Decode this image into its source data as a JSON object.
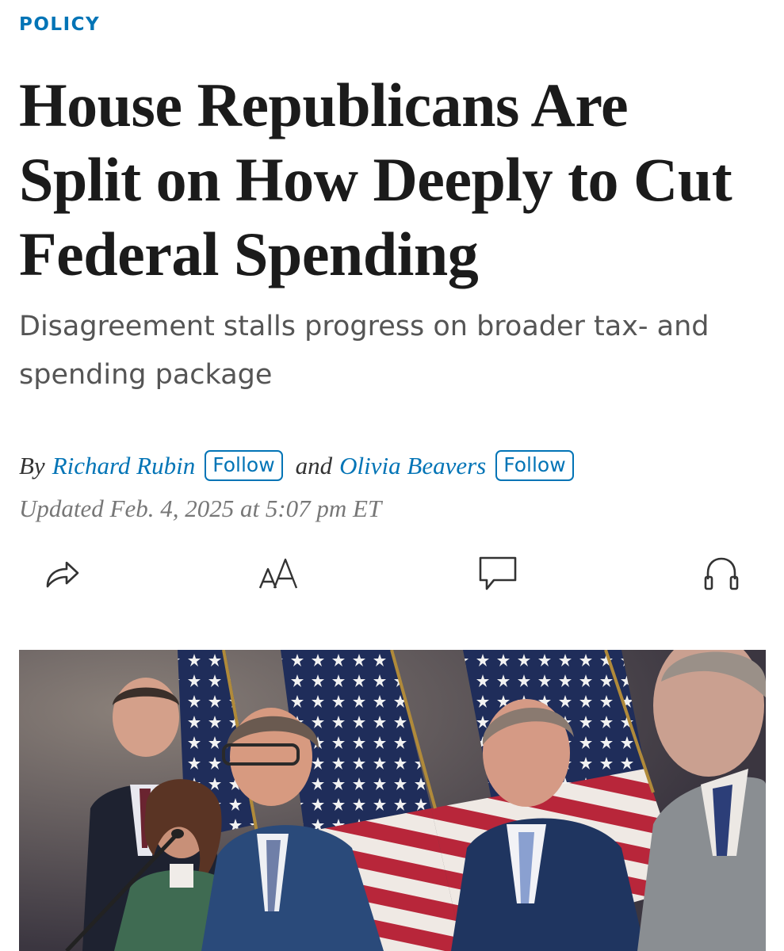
{
  "article": {
    "section": "POLICY",
    "headline": "House Republicans Are Split on How Deeply to Cut Federal Spending",
    "dek": "Disagreement stalls progress on broader tax- and spending package",
    "byline": {
      "prefix": "By",
      "authors": [
        {
          "name": "Richard Rubin",
          "follow_label": "Follow"
        },
        {
          "name": "Olivia Beavers",
          "follow_label": "Follow"
        }
      ],
      "joiner": "and"
    },
    "timestamp": "Updated Feb. 4, 2025 at 5:07 pm ET"
  },
  "toolbar": {
    "icons": [
      "share-icon",
      "text-size-icon",
      "comment-icon",
      "headphones-icon"
    ]
  },
  "photo": {
    "description_icon": "photo"
  },
  "colors": {
    "accent": "#0274b6",
    "headline": "#1b1b1b",
    "dek": "#555555",
    "timestamp": "#777777"
  }
}
